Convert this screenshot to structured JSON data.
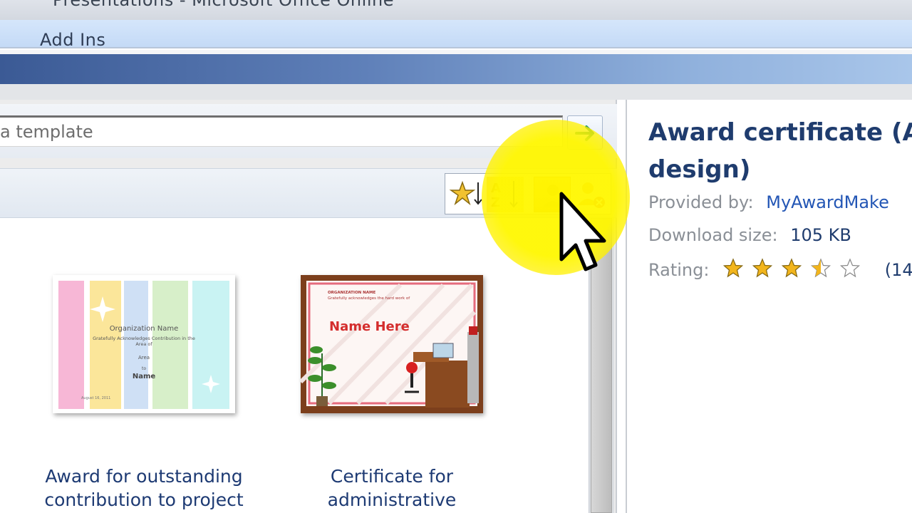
{
  "window": {
    "title": "Presentations - Microsoft Office Online",
    "menu_item": "Add Ins"
  },
  "search": {
    "placeholder": "a template"
  },
  "sort_buttons": [
    {
      "name": "sort-by-rating"
    },
    {
      "name": "sort-by-name"
    },
    {
      "name": "sort-by-provider"
    },
    {
      "name": "filter-provider"
    }
  ],
  "templates": [
    {
      "caption": "Award for outstanding contribution to project",
      "thumb_org": "Organization Name",
      "thumb_line": "Gratefully Acknowledges Contribution in the Area of",
      "thumb_area": "Area",
      "thumb_to": "to",
      "thumb_name": "Name",
      "thumb_date": "August 16, 2011"
    },
    {
      "caption": "Certificate for administrative",
      "thumb_org": "ORGANIZATION NAME",
      "thumb_line": "Gratefully acknowledges the hard work of",
      "thumb_name": "Name Here"
    }
  ],
  "detail": {
    "title_line1": "Award certificate (Ar",
    "title_line2": "design)",
    "provided_by_label": "Provided by:",
    "provided_by_value": "MyAwardMake",
    "download_size_label": "Download size:",
    "download_size_value": "105 KB",
    "rating_label": "Rating:",
    "rating_count": "(14",
    "rating_value": 3.5,
    "rating_max": 5
  },
  "colors": {
    "banner": "#4a6aa5",
    "title_blue": "#1f3c6e",
    "link_blue": "#2356b5",
    "highlight": "#fff700",
    "star": "#f2b51c"
  }
}
